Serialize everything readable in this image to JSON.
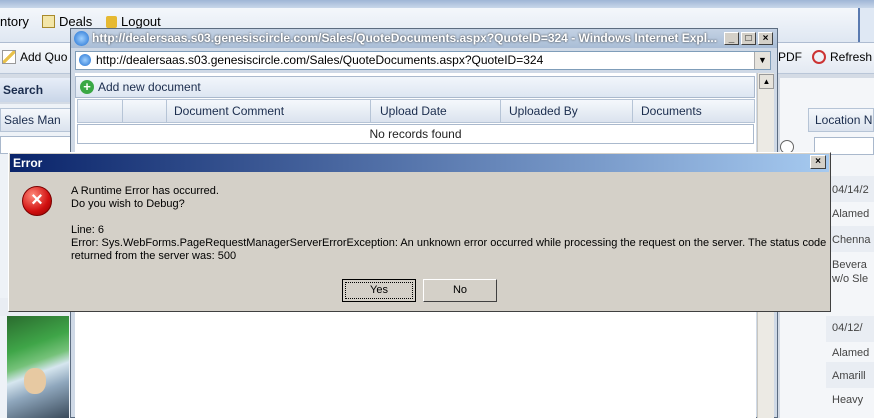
{
  "app": {
    "nav": {
      "inventory": "ntory",
      "deals": "Deals",
      "logout": "Logout"
    },
    "toolbar": {
      "add_quote": "Add Quo",
      "pdf": "PDF",
      "refresh": "Refresh"
    },
    "search_label": "Search",
    "sales_man_header": "Sales Man",
    "location_header": "Location N",
    "right_cells": [
      "04/14/2",
      "Alamed",
      "Chenna",
      "Bevera",
      "w/o Sle",
      "04/12/",
      "Alamed",
      "Amarill",
      "Heavy"
    ]
  },
  "popup": {
    "title": "http://dealersaas.s03.genesiscircle.com/Sales/QuoteDocuments.aspx?QuoteID=324 - Windows Internet Expl...",
    "address": "http://dealersaas.s03.genesiscircle.com/Sales/QuoteDocuments.aspx?QuoteID=324",
    "add_new_document": "Add new document",
    "columns": [
      "Document Comment",
      "Upload Date",
      "Uploaded By",
      "Documents"
    ],
    "empty_message": "No records found"
  },
  "error_dialog": {
    "title": "Error",
    "line1": "A Runtime Error has occurred.",
    "line2": "Do you wish to Debug?",
    "line3": "Line: 6",
    "line4": "Error: Sys.WebForms.PageRequestManagerServerErrorException: An unknown error occurred while processing the request on the server. The status code",
    "line5": "returned from the server was: 500",
    "yes": "Yes",
    "no": "No"
  }
}
